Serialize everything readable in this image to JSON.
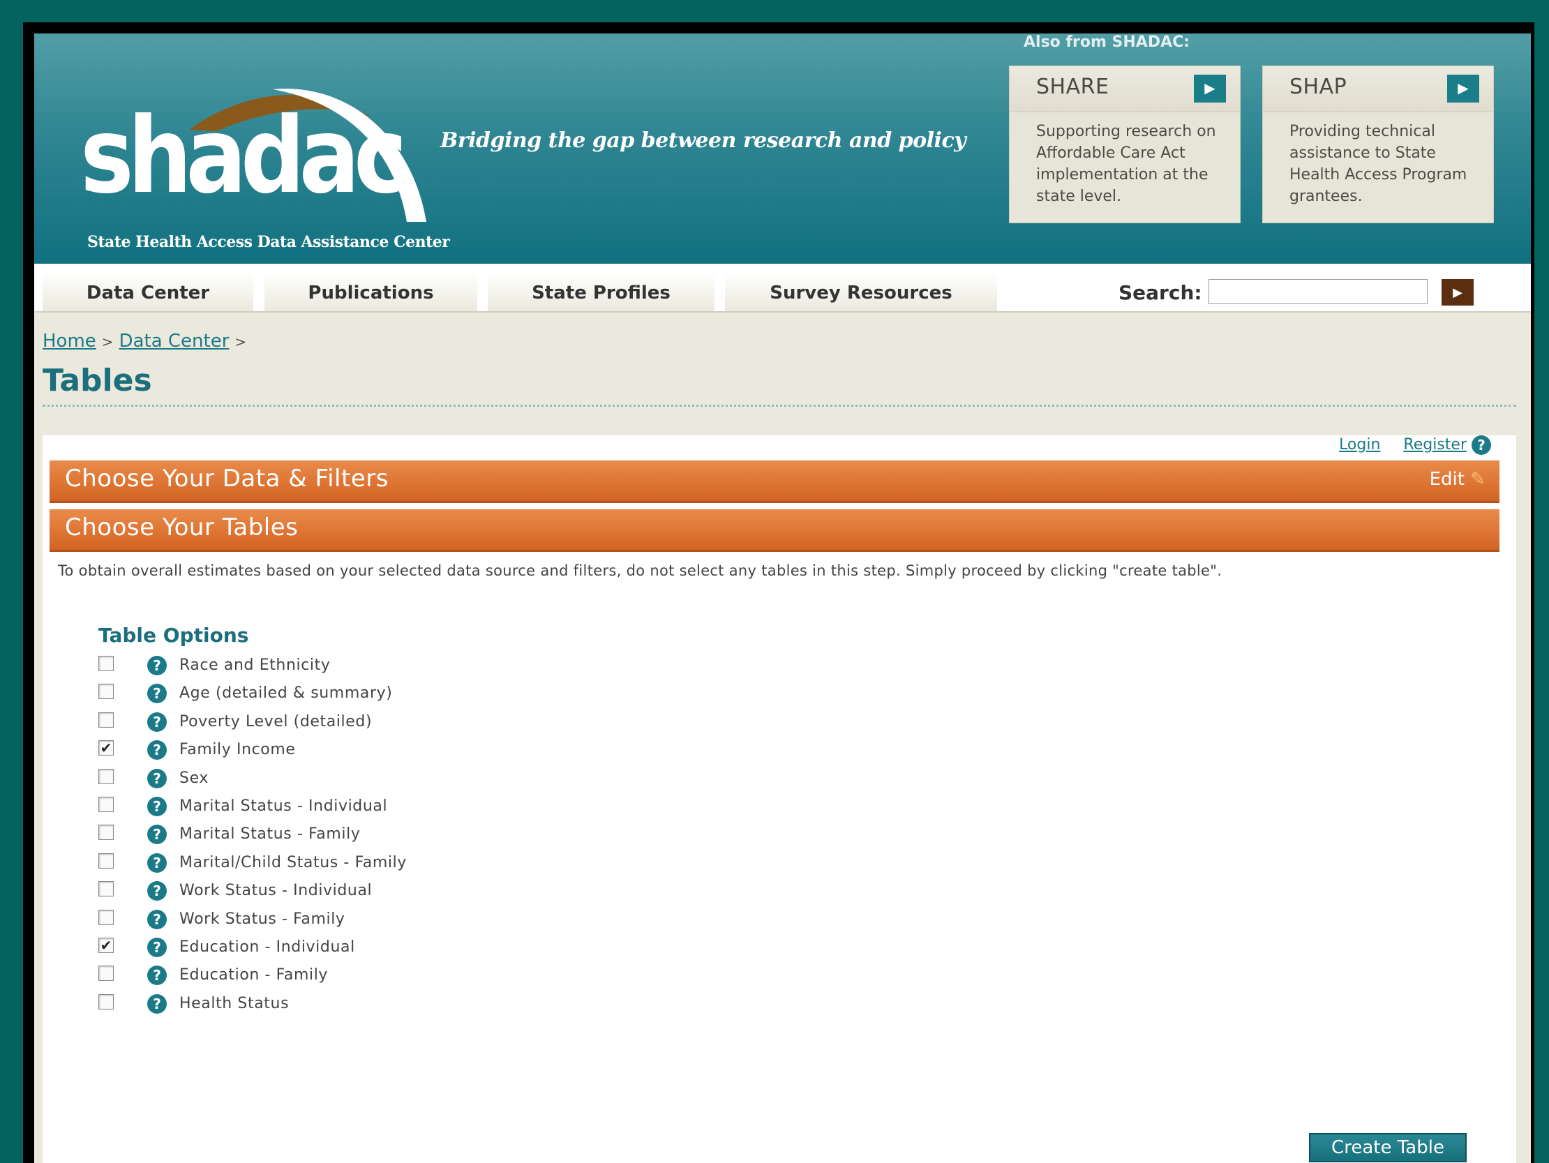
{
  "header": {
    "logo_text": "shadac",
    "logo_subtitle": "State Health Access Data Assistance Center",
    "tagline": "Bridging the gap between research and policy",
    "also_from": "Also from SHADAC:",
    "promos": [
      {
        "title": "SHARE",
        "description": "Supporting research on Affordable Care Act implementation at the state level."
      },
      {
        "title": "SHAP",
        "description": "Providing technical assistance to State Health Access Program grantees."
      }
    ]
  },
  "nav": {
    "tabs": [
      "Data Center",
      "Publications",
      "State Profiles",
      "Survey Resources"
    ],
    "search_label": "Search:",
    "search_value": ""
  },
  "breadcrumb": {
    "home": "Home",
    "data_center": "Data Center",
    "separator": ">"
  },
  "page_title": "Tables",
  "auth": {
    "login": "Login",
    "register": "Register"
  },
  "sections": {
    "data_filters": "Choose Your Data & Filters",
    "edit": "Edit",
    "tables": "Choose Your Tables"
  },
  "instructions": "To obtain overall estimates based on your selected data source and filters, do not select any tables in this step. Simply proceed by clicking \"create table\".",
  "table_options": {
    "heading": "Table Options",
    "items": [
      {
        "label": "Race and Ethnicity",
        "checked": false
      },
      {
        "label": "Age (detailed & summary)",
        "checked": false
      },
      {
        "label": "Poverty Level (detailed)",
        "checked": false
      },
      {
        "label": "Family Income",
        "checked": true
      },
      {
        "label": "Sex",
        "checked": false
      },
      {
        "label": "Marital Status - Individual",
        "checked": false
      },
      {
        "label": "Marital Status - Family",
        "checked": false
      },
      {
        "label": "Marital/Child Status - Family",
        "checked": false
      },
      {
        "label": "Work Status - Individual",
        "checked": false
      },
      {
        "label": "Work Status - Family",
        "checked": false
      },
      {
        "label": "Education - Individual",
        "checked": true
      },
      {
        "label": "Education - Family",
        "checked": false
      },
      {
        "label": "Health Status",
        "checked": false
      }
    ]
  },
  "create_button": "Create Table",
  "colors": {
    "teal": "#1b7a87",
    "orange": "#dd7332",
    "background": "#04625f"
  }
}
